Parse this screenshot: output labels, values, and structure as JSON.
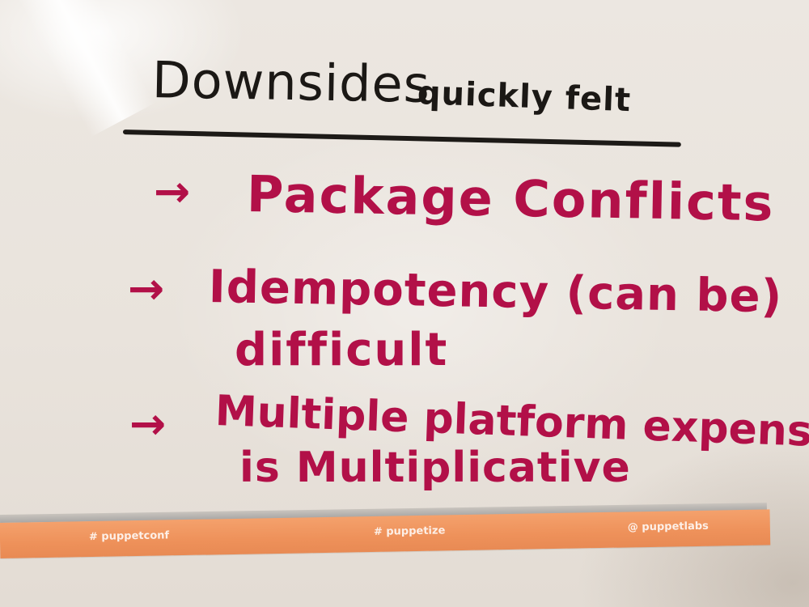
{
  "whiteboard": {
    "heading_main": "Downsides",
    "heading_sub": "quickly felt",
    "bullet_arrow": "→",
    "items": [
      {
        "line1": "Package Conflicts"
      },
      {
        "line1": "Idempotency (can be)",
        "line2": "difficult"
      },
      {
        "line1": "Multiple platform expense",
        "line2": "is Multiplicative"
      }
    ]
  },
  "tape": {
    "tags": [
      "# puppetconf",
      "# puppetize",
      "@ puppetlabs"
    ]
  },
  "colors": {
    "marker_black": "#1b1815",
    "marker_magenta": "#b21048",
    "tape_orange": "#ee915a",
    "board": "#e9e3dc"
  }
}
